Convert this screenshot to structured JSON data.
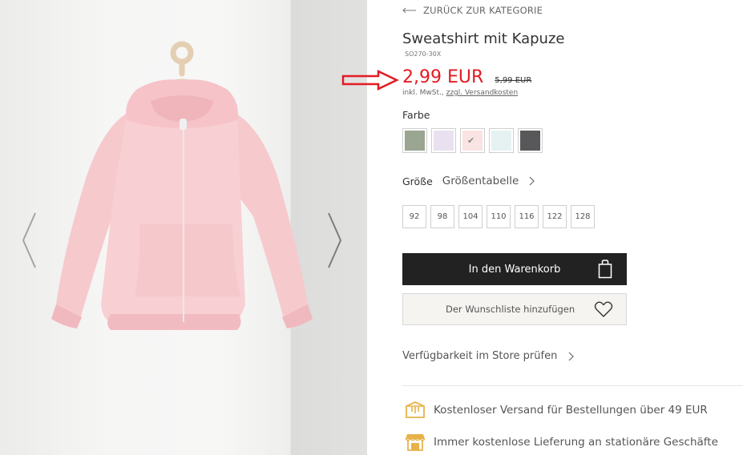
{
  "product": {
    "back_label": "ZURÜCK ZUR KATEGORIE",
    "title": "Sweatshirt mit Kapuze",
    "sku": "SO270-30X",
    "price": "2,99 EUR",
    "old_price": "5,99 EUR",
    "tax_prefix": "inkl. MwSt., ",
    "tax_link": "zzgl. Versandkosten",
    "price_color": "#e31b23"
  },
  "color": {
    "label": "Farbe",
    "swatches": [
      {
        "name": "khaki",
        "hex": "#9aa592",
        "selected": false
      },
      {
        "name": "lavender",
        "hex": "#e9e1ef",
        "selected": false
      },
      {
        "name": "pink",
        "hex": "#f9e3e3",
        "selected": true
      },
      {
        "name": "mint",
        "hex": "#e6f2f1",
        "selected": false
      },
      {
        "name": "dark-grey",
        "hex": "#58585a",
        "selected": false
      }
    ]
  },
  "size": {
    "label": "Größe",
    "table_link": "Größentabelle",
    "options": [
      "92",
      "98",
      "104",
      "110",
      "116",
      "122",
      "128"
    ]
  },
  "actions": {
    "cart_label": "In den Warenkorb",
    "wishlist_label": "Der Wunschliste hinzufügen",
    "store_label": "Verfügbarkeit im Store prüfen"
  },
  "info": {
    "shipping": "Kostenloser Versand für Bestellungen über 49 EUR",
    "store_delivery": "Immer kostenlose Lieferung an stationäre Geschäfte",
    "icon_color": "#e8b24a"
  },
  "icons": {
    "back": "arrow-left-icon",
    "prev": "chevron-left-icon",
    "next": "chevron-right-icon",
    "bag": "shopping-bag-icon",
    "heart": "heart-icon",
    "box": "package-icon",
    "shop": "storefront-icon"
  }
}
